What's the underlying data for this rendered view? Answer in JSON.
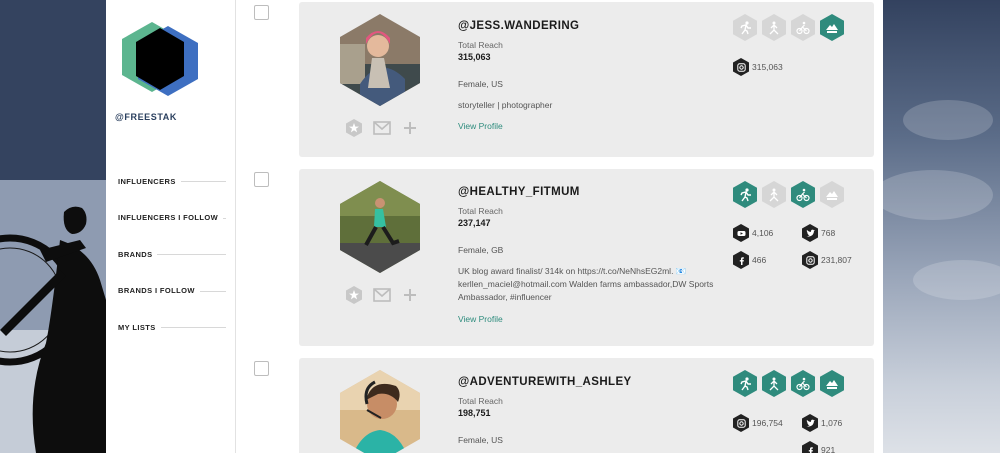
{
  "sidebar": {
    "handle": "@FREESTAK",
    "nav": [
      "INFLUENCERS",
      "INFLUENCERS I FOLLOW",
      "BRANDS",
      "BRANDS I FOLLOW",
      "MY LISTS"
    ]
  },
  "cards": [
    {
      "handle": "@JESS.WANDERING",
      "reach_label": "Total Reach",
      "reach": "315,063",
      "demo": "Female, US",
      "bio": "storyteller | photographer",
      "view_profile": "View Profile",
      "categories": [
        {
          "icon": "running-icon",
          "active": false
        },
        {
          "icon": "triathlon-icon",
          "active": false
        },
        {
          "icon": "cycling-icon",
          "active": false
        },
        {
          "icon": "outdoors-icon",
          "active": true
        }
      ],
      "social": [
        {
          "icon": "instagram-icon",
          "count": "315,063"
        }
      ]
    },
    {
      "handle": "@HEALTHY_FITMUM",
      "reach_label": "Total Reach",
      "reach": "237,147",
      "demo": "Female, GB",
      "bio": "UK blog award finalist/ 314k on https://t.co/NeNhsEG2ml. 📧 kerllen_maciel@hotmail.com Walden farms ambassador,DW Sports Ambassador, #influencer",
      "view_profile": "View Profile",
      "categories": [
        {
          "icon": "running-icon",
          "active": true
        },
        {
          "icon": "triathlon-icon",
          "active": false
        },
        {
          "icon": "cycling-icon",
          "active": true
        },
        {
          "icon": "outdoors-icon",
          "active": false
        }
      ],
      "social": [
        {
          "icon": "youtube-icon",
          "count": "4,106"
        },
        {
          "icon": "twitter-icon",
          "count": "768"
        },
        {
          "icon": "facebook-icon",
          "count": "466"
        },
        {
          "icon": "instagram-icon",
          "count": "231,807"
        }
      ]
    },
    {
      "handle": "@ADVENTUREWITH_ASHLEY",
      "reach_label": "Total Reach",
      "reach": "198,751",
      "demo": "Female, US",
      "bio": "",
      "view_profile": "",
      "categories": [
        {
          "icon": "running-icon",
          "active": true
        },
        {
          "icon": "triathlon-icon",
          "active": true
        },
        {
          "icon": "cycling-icon",
          "active": true
        },
        {
          "icon": "outdoors-icon",
          "active": true
        }
      ],
      "social": [
        {
          "icon": "instagram-icon",
          "count": "196,754"
        },
        {
          "icon": "twitter-icon",
          "count": "1,076"
        },
        {
          "icon": "facebook-icon",
          "count": "921"
        }
      ]
    }
  ],
  "colors": {
    "accent": "#2f8b7d",
    "inactive": "#d6d6d6",
    "card_bg": "#ececec",
    "logo_green": "#5cb58f",
    "logo_blue": "#3e6fc1"
  }
}
